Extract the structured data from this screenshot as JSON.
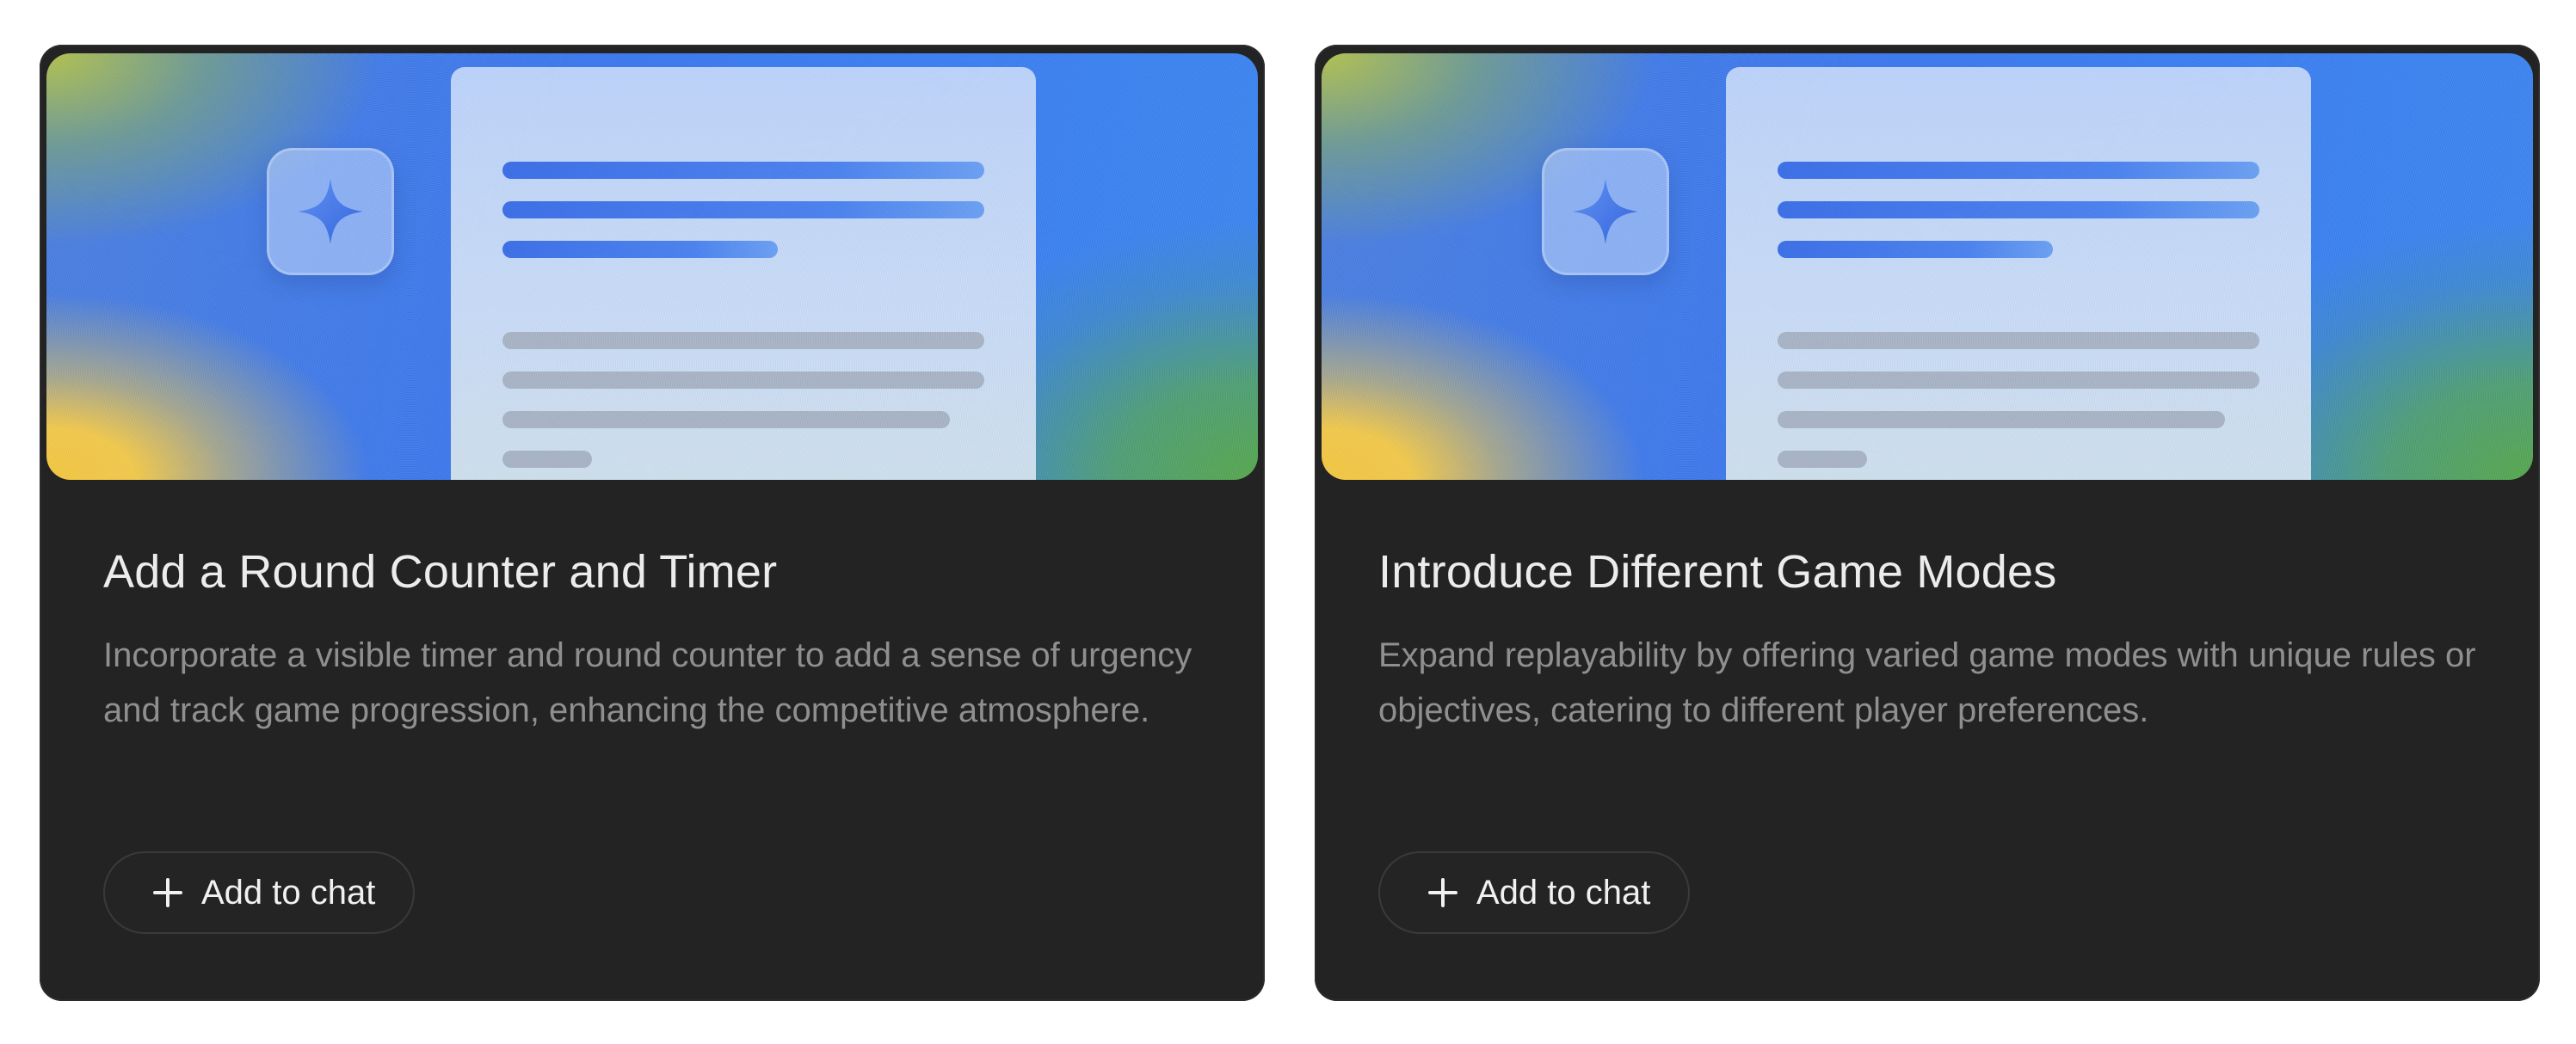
{
  "cards": [
    {
      "title": "Add a Round Counter and Timer",
      "description": "Incorporate a visible timer and round counter to add a sense of urgency and track game progression, enhancing the competitive atmosphere.",
      "button_label": "Add to chat",
      "button_icon": "plus-icon",
      "banner_icon": "sparkle-icon"
    },
    {
      "title": "Introduce Different Game Modes",
      "description": "Expand replayability by offering varied game modes with unique rules or objectives, catering to different player preferences.",
      "button_label": "Add to chat",
      "button_icon": "plus-icon",
      "banner_icon": "sparkle-icon"
    }
  ],
  "colors": {
    "card_background": "#232323",
    "title_text": "#ececec",
    "description_text": "#8f8f8f",
    "accent_blue": "#3b78ef"
  }
}
